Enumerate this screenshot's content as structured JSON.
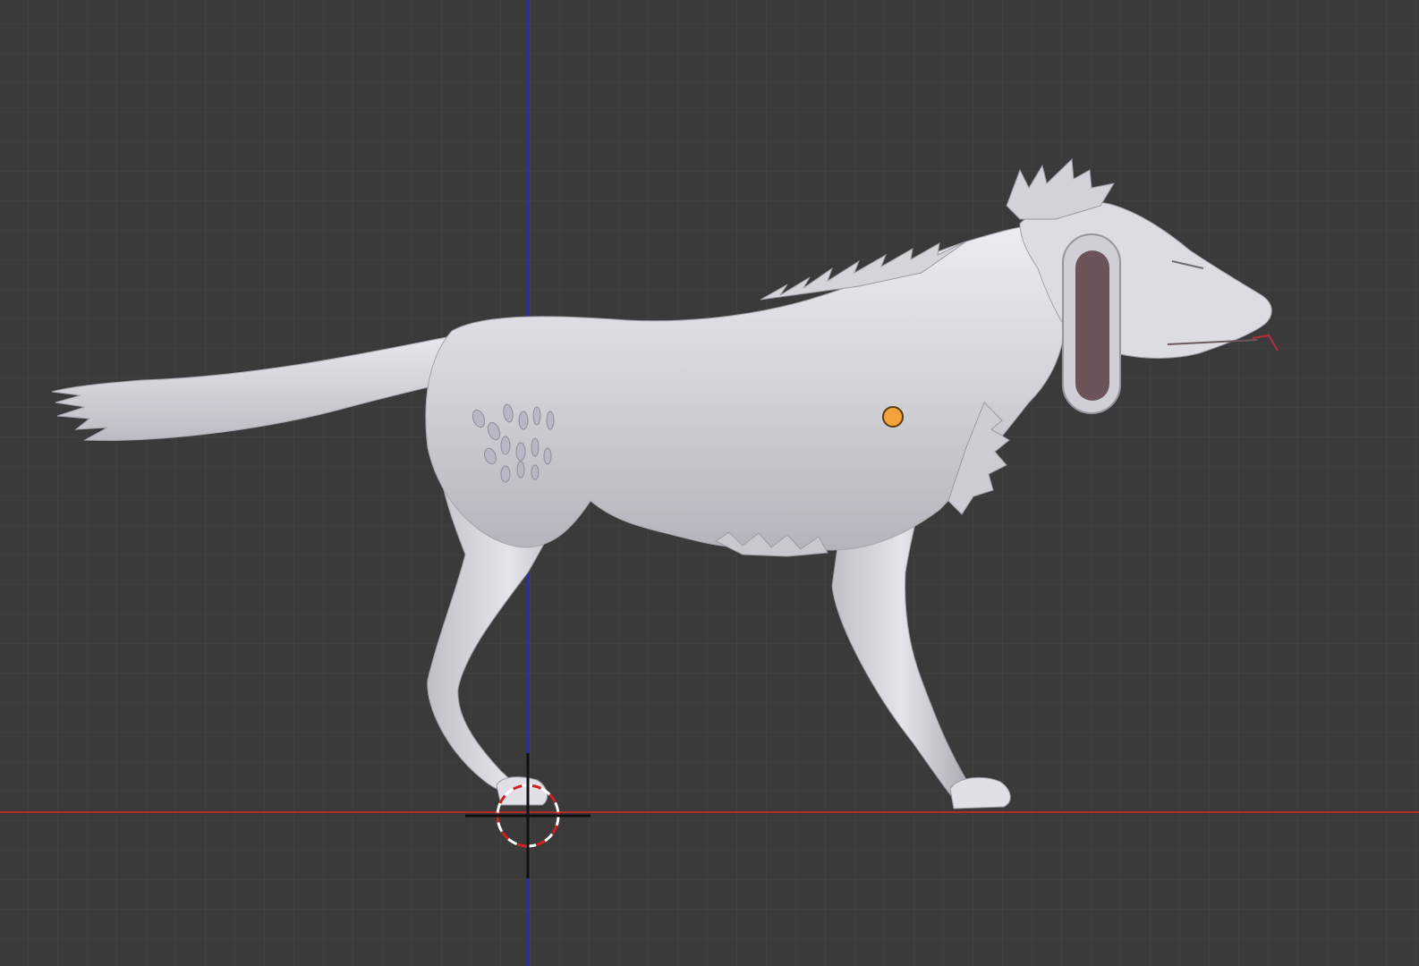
{
  "viewport": {
    "view": "3d-viewport-side-view",
    "background_color": "#3a3a3a",
    "grid_color": "#444444",
    "x_axis_color": "#b5282b",
    "z_axis_color": "#2a2fa8",
    "origin_dot_color": "#f2a33a",
    "model_color": "#d6d6dc",
    "ear_inner_color": "#6a5458",
    "tongue_color": "#b82e3e"
  },
  "scene": {
    "object": "wolf-model",
    "has_3d_cursor": true,
    "has_origin_point": true
  }
}
